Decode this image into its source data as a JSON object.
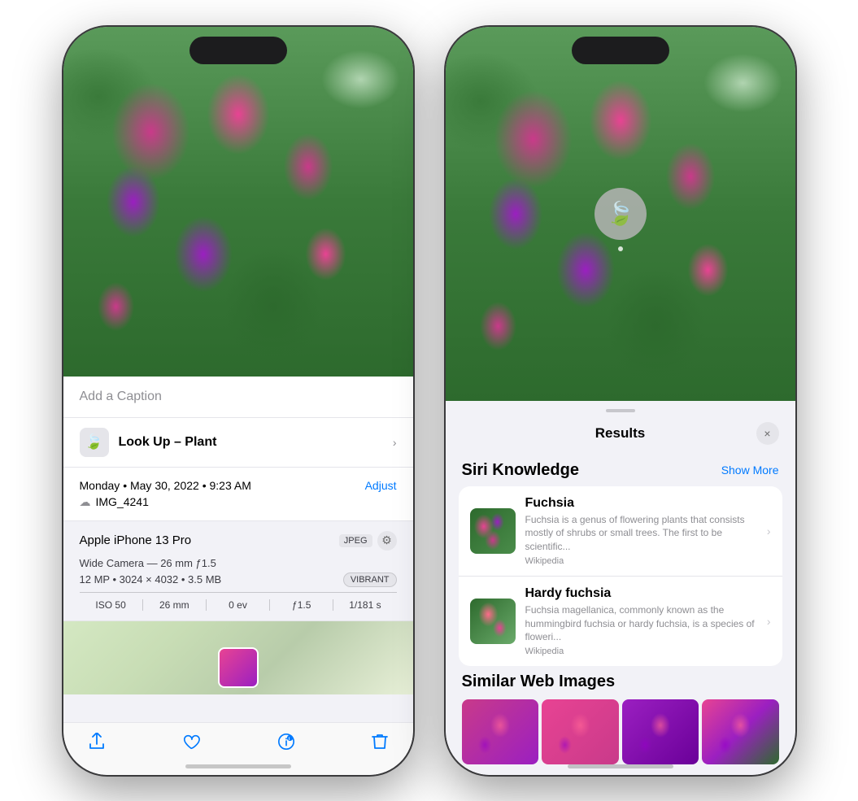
{
  "left_phone": {
    "caption_placeholder": "Add a Caption",
    "lookup_label": "Look Up –",
    "lookup_subject": "Plant",
    "date_info": "Monday • May 30, 2022 • 9:23 AM",
    "adjust_label": "Adjust",
    "filename": "IMG_4241",
    "device_name": "Apple iPhone 13 Pro",
    "jpeg_badge": "JPEG",
    "camera_details": "Wide Camera — 26 mm ƒ1.5",
    "mp_info": "12 MP • 3024 × 4032 • 3.5 MB",
    "vibrant_badge": "VIBRANT",
    "exif": {
      "iso": "ISO 50",
      "mm": "26 mm",
      "ev": "0 ev",
      "aperture": "ƒ1.5",
      "shutter": "1/181 s"
    },
    "toolbar": {
      "share": "⬆",
      "like": "♡",
      "info": "✦",
      "delete": "🗑"
    }
  },
  "right_phone": {
    "results_title": "Results",
    "close_label": "×",
    "siri_knowledge_title": "Siri Knowledge",
    "show_more_label": "Show More",
    "items": [
      {
        "name": "Fuchsia",
        "description": "Fuchsia is a genus of flowering plants that consists mostly of shrubs or small trees. The first to be scientific...",
        "source": "Wikipedia"
      },
      {
        "name": "Hardy fuchsia",
        "description": "Fuchsia magellanica, commonly known as the hummingbird fuchsia or hardy fuchsia, is a species of floweri...",
        "source": "Wikipedia"
      }
    ],
    "similar_title": "Similar Web Images"
  }
}
